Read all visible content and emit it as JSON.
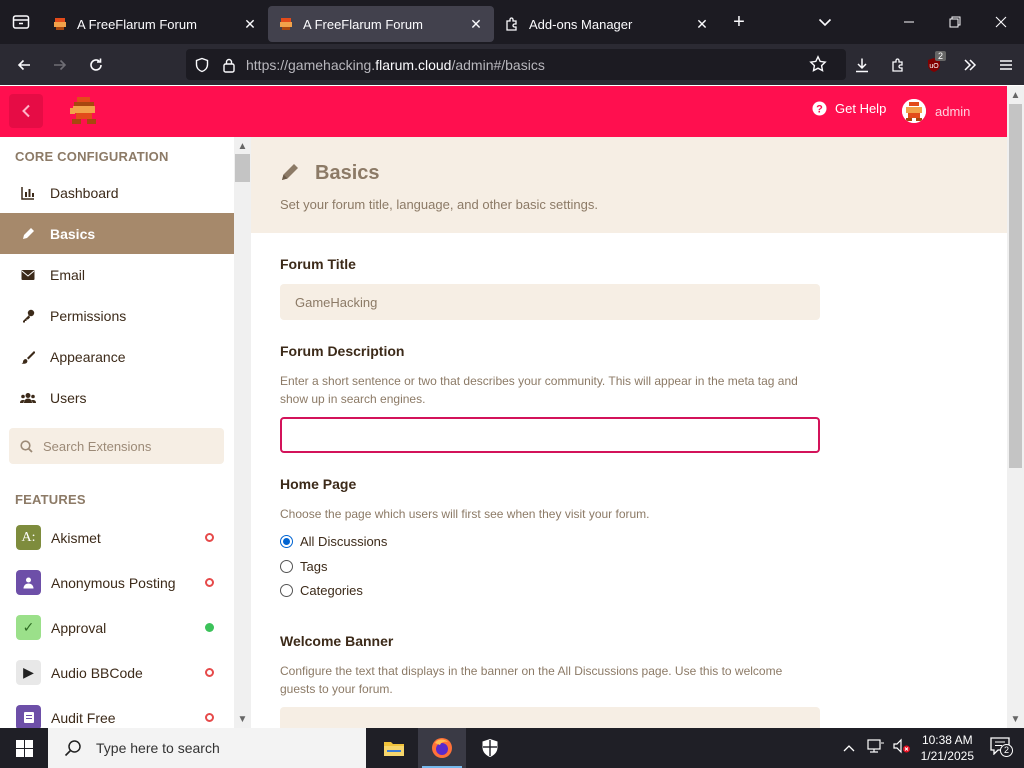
{
  "browser": {
    "tabs": [
      {
        "title": "A FreeFlarum Forum",
        "active": false
      },
      {
        "title": "A FreeFlarum Forum",
        "active": true
      },
      {
        "title": "Add-ons Manager",
        "active": false
      }
    ],
    "url_prefix": "https://gamehacking.",
    "url_domain": "flarum.cloud",
    "url_suffix": "/admin#/basics",
    "extension_badge_count": "2"
  },
  "header": {
    "help_label": "Get Help",
    "username": "admin"
  },
  "sidebar": {
    "core_heading": "CORE CONFIGURATION",
    "items": [
      {
        "label": "Dashboard",
        "icon": "chart-icon"
      },
      {
        "label": "Basics",
        "icon": "pencil-icon",
        "active": true
      },
      {
        "label": "Email",
        "icon": "envelope-icon"
      },
      {
        "label": "Permissions",
        "icon": "key-icon"
      },
      {
        "label": "Appearance",
        "icon": "paintbrush-icon"
      },
      {
        "label": "Users",
        "icon": "users-icon"
      }
    ],
    "search_placeholder": "Search Extensions",
    "features_heading": "FEATURES",
    "extensions": [
      {
        "label": "Akismet",
        "badge_color": "#7e8c3d",
        "badge_text": "A:",
        "enabled": false
      },
      {
        "label": "Anonymous Posting",
        "badge_color": "#6d4fa8",
        "badge_text": "",
        "enabled": false
      },
      {
        "label": "Approval",
        "badge_color": "#9be08a",
        "badge_text": "✓",
        "enabled": true
      },
      {
        "label": "Audio BBCode",
        "badge_color": "#e8e8e8",
        "badge_text": "▶",
        "enabled": false
      },
      {
        "label": "Audit Free",
        "badge_color": "#6d4fa8",
        "badge_text": "",
        "enabled": false
      }
    ]
  },
  "page": {
    "title": "Basics",
    "description": "Set your forum title, language, and other basic settings.",
    "forum_title_label": "Forum Title",
    "forum_title_value": "GameHacking",
    "forum_desc_label": "Forum Description",
    "forum_desc_help": "Enter a short sentence or two that describes your community. This will appear in the meta tag and show up in search engines.",
    "forum_desc_value": "",
    "home_page_label": "Home Page",
    "home_page_help": "Choose the page which users will first see when they visit your forum.",
    "home_options": [
      {
        "label": "All Discussions",
        "checked": true
      },
      {
        "label": "Tags",
        "checked": false
      },
      {
        "label": "Categories",
        "checked": false
      }
    ],
    "welcome_label": "Welcome Banner",
    "welcome_help": "Configure the text that displays in the banner on the All Discussions page. Use this to welcome guests to your forum."
  },
  "taskbar": {
    "search_placeholder": "Type here to search",
    "time": "10:38 AM",
    "date": "1/21/2025",
    "notification_count": "2"
  },
  "colors": {
    "brand": "#ff0f4f",
    "sidebar_active": "#a6896b",
    "accent_text": "#8c7a66",
    "control_bg": "#f6eee4"
  }
}
